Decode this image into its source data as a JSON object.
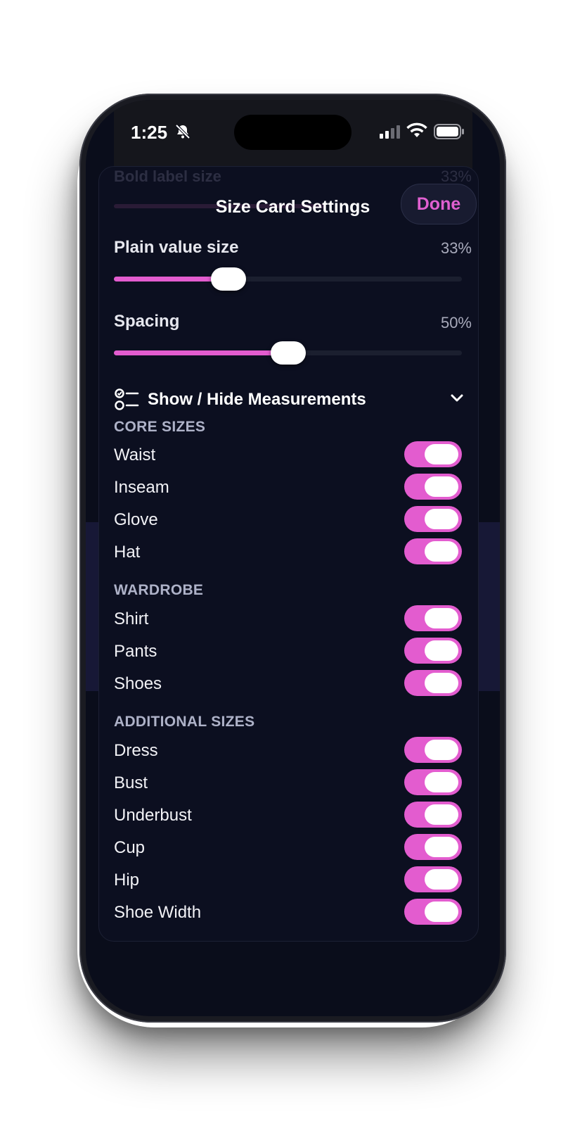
{
  "status_bar": {
    "time": "1:25"
  },
  "header": {
    "title": "Size Card Settings",
    "done_label": "Done"
  },
  "ghost": {
    "label": "Bold label size",
    "value": "33%"
  },
  "sliders": [
    {
      "label": "Plain value size",
      "value_text": "33%",
      "value": 0.33
    },
    {
      "label": "Spacing",
      "value_text": "50%",
      "value": 0.5
    }
  ],
  "section": {
    "label": "Show / Hide Measurements"
  },
  "groups": [
    {
      "title": "CORE SIZES",
      "items": [
        {
          "label": "Waist",
          "on": true
        },
        {
          "label": "Inseam",
          "on": true
        },
        {
          "label": "Glove",
          "on": true
        },
        {
          "label": "Hat",
          "on": true
        }
      ]
    },
    {
      "title": "WARDROBE",
      "items": [
        {
          "label": "Shirt",
          "on": true
        },
        {
          "label": "Pants",
          "on": true
        },
        {
          "label": "Shoes",
          "on": true
        }
      ]
    },
    {
      "title": "ADDITIONAL SIZES",
      "items": [
        {
          "label": "Dress",
          "on": true
        },
        {
          "label": "Bust",
          "on": true
        },
        {
          "label": "Underbust",
          "on": true
        },
        {
          "label": "Cup",
          "on": true
        },
        {
          "label": "Hip",
          "on": true
        },
        {
          "label": "Shoe Width",
          "on": true
        }
      ]
    }
  ],
  "colors": {
    "accent": "#e35ccf",
    "background": "#0a0d1b",
    "done_text": "#e060d0"
  }
}
